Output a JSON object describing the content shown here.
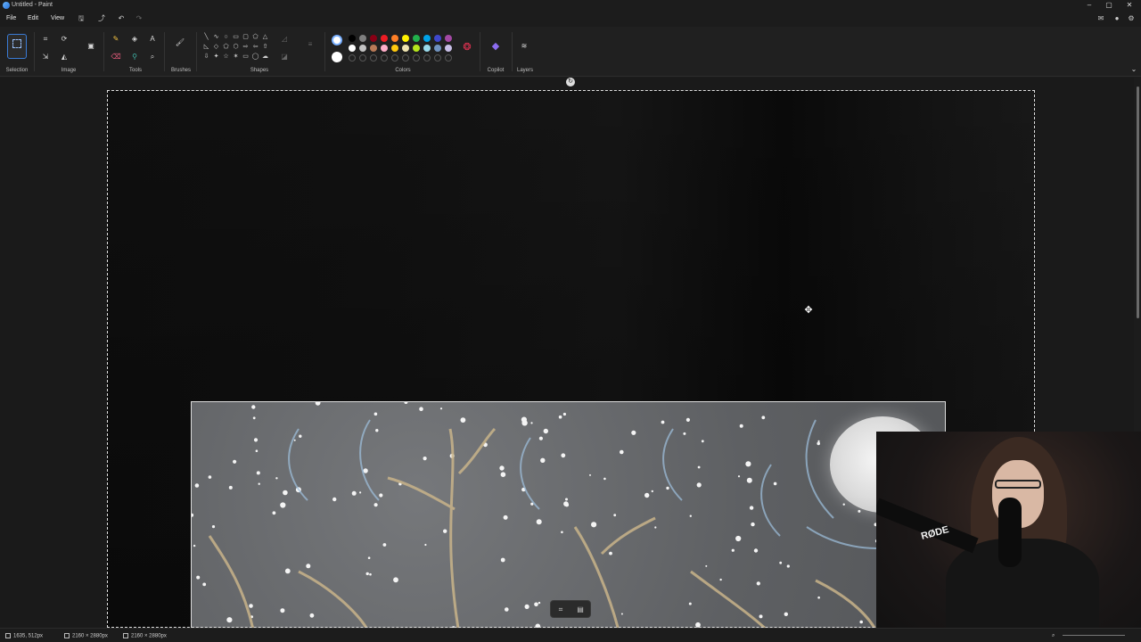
{
  "window": {
    "title": "Untitled - Paint",
    "minimize": "–",
    "maximize": "▢",
    "close": "✕"
  },
  "menu": {
    "file": "File",
    "edit": "Edit",
    "view": "View"
  },
  "ribbon": {
    "groups": {
      "selection": "Selection",
      "image": "Image",
      "tools": "Tools",
      "brushes": "Brushes",
      "shapes": "Shapes",
      "colors": "Colors",
      "copilot": "Copilot",
      "layers": "Layers"
    },
    "palette_top": [
      "#000000",
      "#7f7f7f",
      "#880015",
      "#ed1c24",
      "#ff7f27",
      "#fff200",
      "#22b14c",
      "#00a2e8",
      "#3f48cc",
      "#a349a4"
    ],
    "palette_bottom": [
      "#ffffff",
      "#c3c3c3",
      "#b97a57",
      "#ffaec9",
      "#ffc90e",
      "#efe4b0",
      "#b5e61d",
      "#99d9ea",
      "#7092be",
      "#c8bfe7"
    ],
    "current_color_1": "#ffffff",
    "current_color_2": "#ffffff"
  },
  "canvas": {
    "content": "pasted photo of a night-sky painting",
    "webcam_brand": "RØDE"
  },
  "status": {
    "cursor_position": "1635, 512px",
    "selection_size": "2160 × 2880px",
    "canvas_size": "2160 × 2880px"
  }
}
